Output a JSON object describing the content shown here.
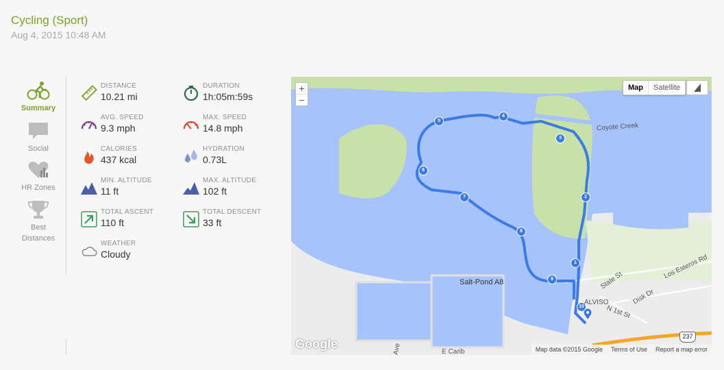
{
  "activity": {
    "title": "Cycling (Sport)",
    "datetime": "Aug 4, 2015 10:48 AM"
  },
  "nav": {
    "summary": "Summary",
    "social": "Social",
    "hr_zones": "HR Zones",
    "best_distances_1": "Best",
    "best_distances_2": "Distances"
  },
  "stats": {
    "distance": {
      "label": "DISTANCE",
      "value": "10.21 mi"
    },
    "duration": {
      "label": "DURATION",
      "value": "1h:05m:59s"
    },
    "avg_speed": {
      "label": "AVG. SPEED",
      "value": "9.3 mph"
    },
    "max_speed": {
      "label": "MAX. SPEED",
      "value": "14.8 mph"
    },
    "calories": {
      "label": "CALORIES",
      "value": "437 kcal"
    },
    "hydration": {
      "label": "HYDRATION",
      "value": "0.73L"
    },
    "min_altitude": {
      "label": "MIN. ALTITUDE",
      "value": "11 ft"
    },
    "max_altitude": {
      "label": "MAX. ALTITUDE",
      "value": "102 ft"
    },
    "total_ascent": {
      "label": "TOTAL ASCENT",
      "value": "110 ft"
    },
    "total_descent": {
      "label": "TOTAL DESCENT",
      "value": "33 ft"
    },
    "weather": {
      "label": "WEATHER",
      "value": "Cloudy"
    }
  },
  "map": {
    "zoom_in": "+",
    "zoom_out": "−",
    "type_map": "Map",
    "type_satellite": "Satellite",
    "google": "Google",
    "attribution": "Map data ©2015 Google",
    "terms": "Terms of Use",
    "report": "Report a map error",
    "places": {
      "coyote_creek": "Coyote Creek",
      "salt_pond": "Salt-Pond A8",
      "alviso": "ALVISO",
      "state_st": "State St",
      "los_esteros": "Los Esteros Rd",
      "disk_dr": "Disk Dr",
      "n1st": "N 1st St",
      "e_carib": "E Carib",
      "ave": "Ave",
      "hwy": "237"
    },
    "markers": [
      "1",
      "2",
      "3",
      "4",
      "5",
      "6",
      "7",
      "8",
      "9",
      "10"
    ]
  },
  "colors": {
    "accent": "#7aa12a",
    "route": "#3b7be8",
    "water": "#a6c4fb",
    "land": "#c7e1a9"
  }
}
